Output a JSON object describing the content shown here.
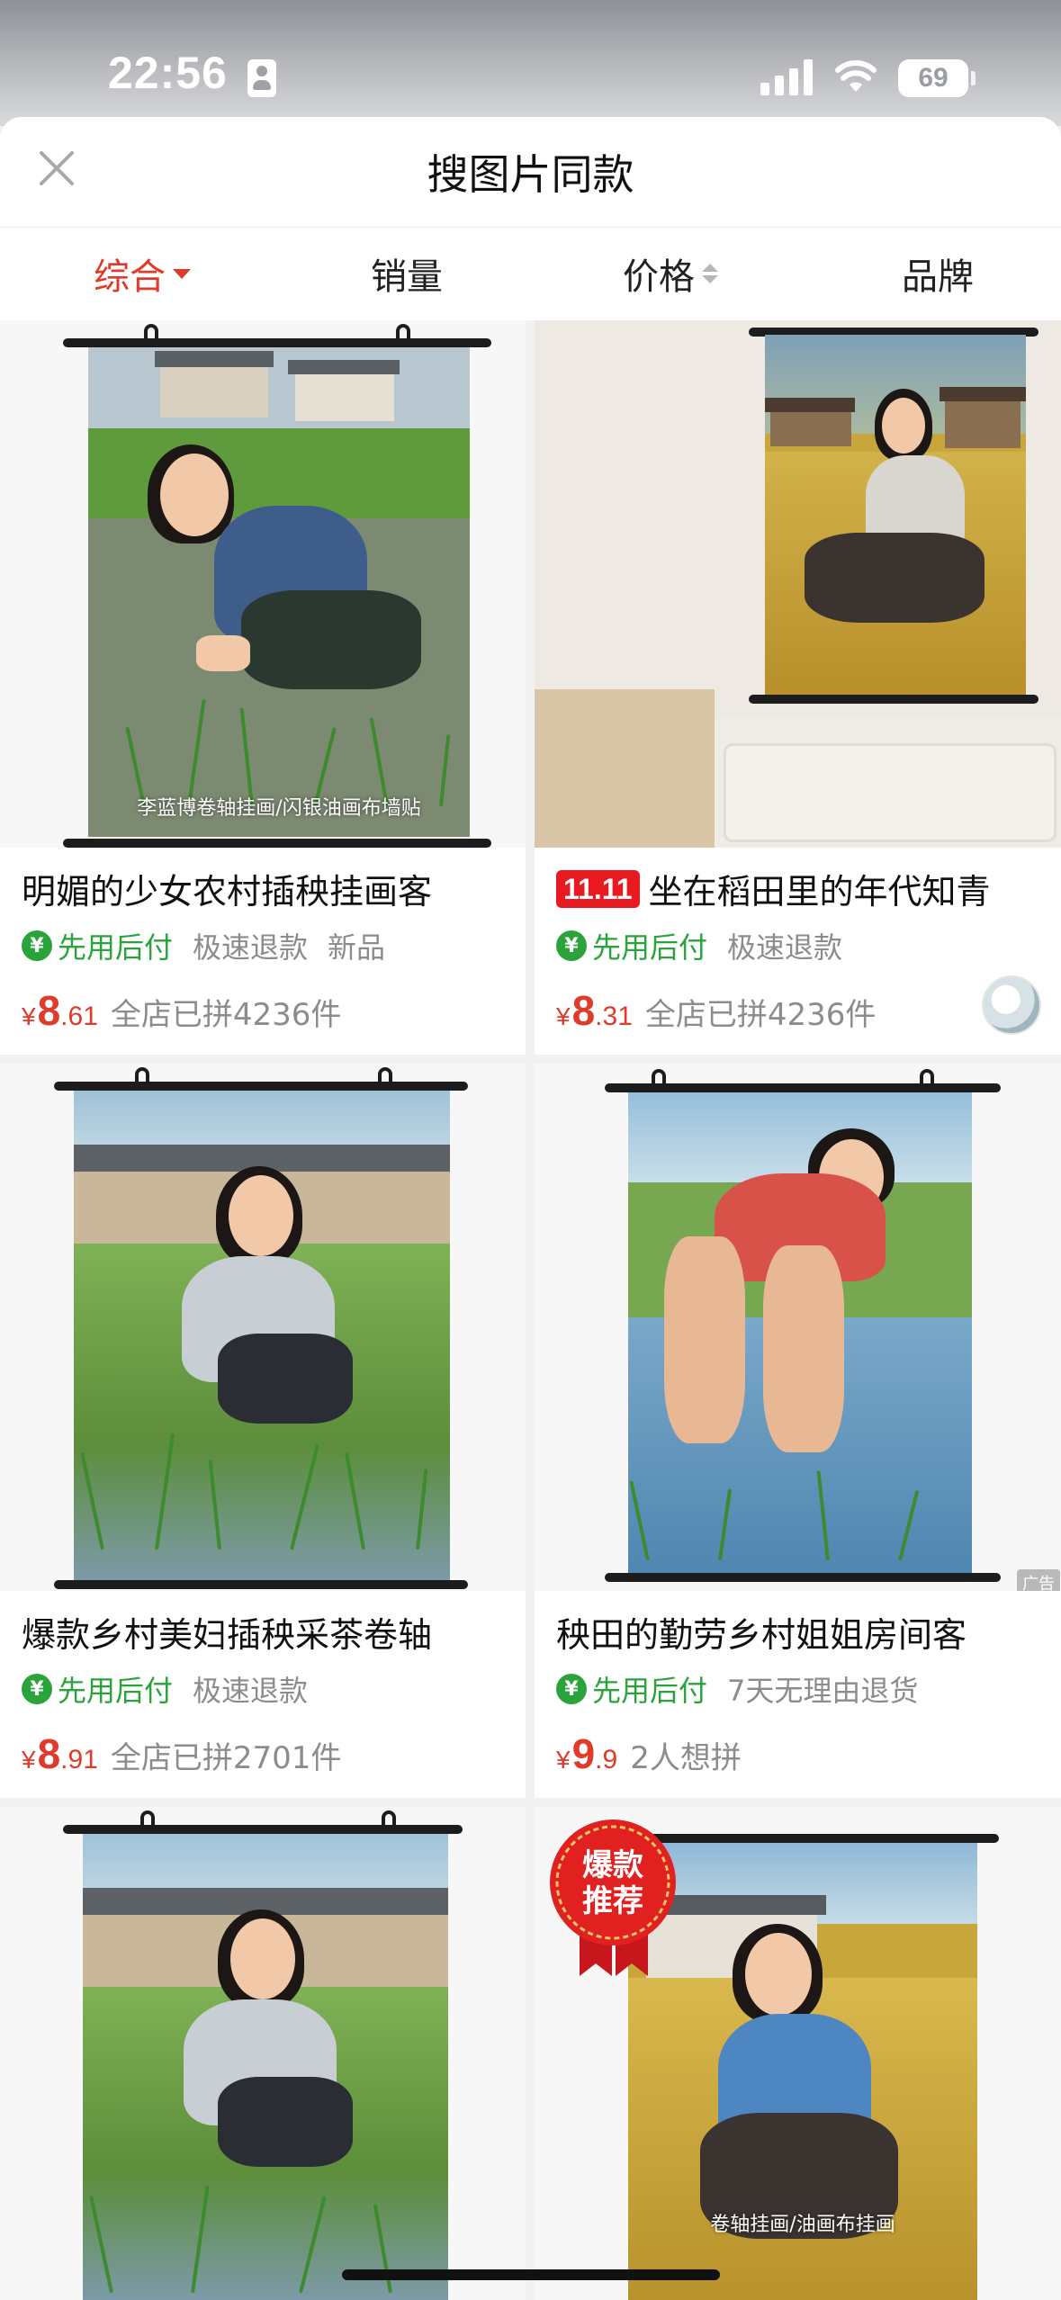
{
  "status_bar": {
    "time": "22:56",
    "battery": "69"
  },
  "header": {
    "title": "搜图片同款"
  },
  "sort_tabs": [
    {
      "label": "综合",
      "active": true
    },
    {
      "label": "销量",
      "active": false
    },
    {
      "label": "价格",
      "active": false
    },
    {
      "label": "品牌",
      "active": false
    }
  ],
  "colors": {
    "accent": "#e03a2a",
    "pay_green": "#2aa33b",
    "promo_red": "#e8191f"
  },
  "products": [
    {
      "title": "明媚的少女农村插秧挂画客",
      "tags": [
        "先用后付",
        "极速退款",
        "新品"
      ],
      "price_currency": "¥",
      "price_int": "8",
      "price_dec": ".61",
      "sales": "全店已拼4236件",
      "image_caption": "李蓝博卷轴挂画/闪银油画布墙贴"
    },
    {
      "promo": "11.11",
      "title": "坐在稻田里的年代知青",
      "tags": [
        "先用后付",
        "极速退款"
      ],
      "price_currency": "¥",
      "price_int": "8",
      "price_dec": ".31",
      "sales": "全店已拼4236件"
    },
    {
      "title": "爆款乡村美妇插秧采茶卷轴",
      "tags": [
        "先用后付",
        "极速退款"
      ],
      "price_currency": "¥",
      "price_int": "8",
      "price_dec": ".91",
      "sales": "全店已拼2701件"
    },
    {
      "title": "秧田的勤劳乡村姐姐房间客",
      "tags": [
        "先用后付",
        "7天无理由退货"
      ],
      "price_currency": "¥",
      "price_int": "9",
      "price_dec": ".9",
      "sales": "2人想拼",
      "ad_label": "广告"
    },
    {
      "title": ""
    },
    {
      "hot_badge": [
        "爆款",
        "推荐"
      ],
      "image_caption": "卷轴挂画/油画布挂画"
    }
  ]
}
